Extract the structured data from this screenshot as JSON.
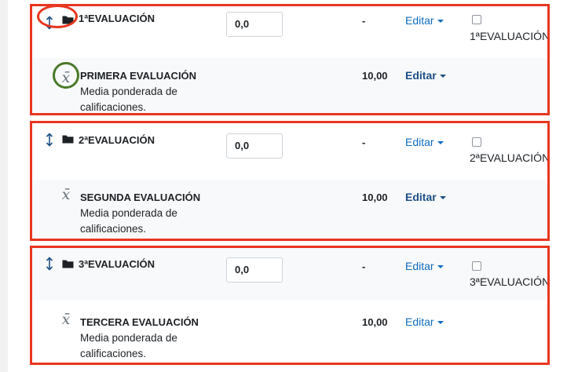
{
  "sections": [
    {
      "category": {
        "name": "1ªEVALUACIÓN",
        "grade_value": "0,0",
        "range_dash": "-",
        "edit_label": "Editar",
        "checkbox_label": "1ªEVALUACIÓN"
      },
      "item": {
        "name": "PRIMERA EVALUACIÓN",
        "description": "Media ponderada de calificaciones.",
        "max_grade": "10,00",
        "edit_label": "Editar",
        "icon": "mean-x-bar-icon"
      }
    },
    {
      "category": {
        "name": "2ªEVALUACIÓN",
        "grade_value": "0,0",
        "range_dash": "-",
        "edit_label": "Editar",
        "checkbox_label": "2ªEVALUACIÓN"
      },
      "item": {
        "name": "SEGUNDA EVALUACIÓN",
        "description": "Media ponderada de calificaciones.",
        "max_grade": "10,00",
        "edit_label": "Editar",
        "icon": "mean-x-bar-icon"
      }
    },
    {
      "category": {
        "name": "3ªEVALUACIÓN",
        "grade_value": "0,0",
        "range_dash": "-",
        "edit_label": "Editar",
        "checkbox_label": "3ªEVALUACIÓN"
      },
      "item": {
        "name": "TERCERA EVALUACIÓN",
        "description": "Media ponderada de calificaciones.",
        "max_grade": "10,00",
        "edit_label": "Editar",
        "icon": "mean-x-bar-icon"
      }
    }
  ],
  "mean_symbol": "x̄",
  "colors": {
    "highlight_border": "#e8361f",
    "highlight_circle_green": "#4a7a2a",
    "link": "#0f6cbf"
  }
}
